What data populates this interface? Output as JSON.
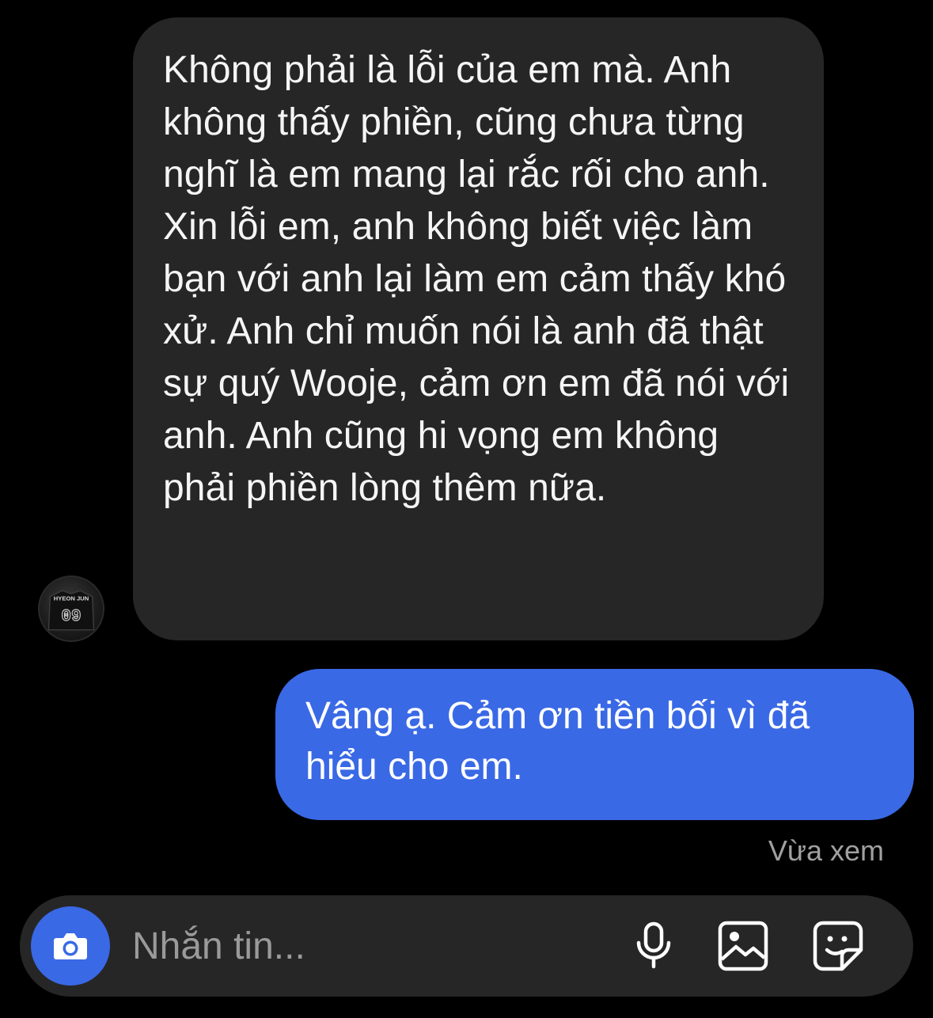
{
  "thread": {
    "received_message": {
      "text": "Không phải là lỗi của em mà. Anh không thấy phiền, cũng chưa từng nghĩ là em mang lại rắc rối cho anh. Xin lỗi em, anh không biết việc làm bạn với anh lại làm em cảm thấy khó xử. Anh chỉ muốn nói là anh đã thật sự quý Wooje, cảm ơn em đã nói với anh. Anh cũng hi vọng em không phải phiền lòng thêm nữa.",
      "avatar": {
        "icon": "avatar-jersey",
        "jersey_name": "HYEON JUN",
        "jersey_number": "09"
      }
    },
    "sent_message": {
      "text": "Vâng ạ. Cảm ơn tiền bối vì đã hiểu cho em."
    },
    "seen_status": "Vừa xem"
  },
  "composer": {
    "placeholder": "Nhắn tin...",
    "value": "",
    "camera_icon": "camera-icon",
    "mic_icon": "microphone-icon",
    "gallery_icon": "image-icon",
    "sticker_icon": "sticker-icon"
  },
  "colors": {
    "background": "#000000",
    "received_bubble": "#262626",
    "sent_bubble": "#3a69e6",
    "composer_bg": "#262626",
    "seen_text": "#a0a0a0"
  }
}
